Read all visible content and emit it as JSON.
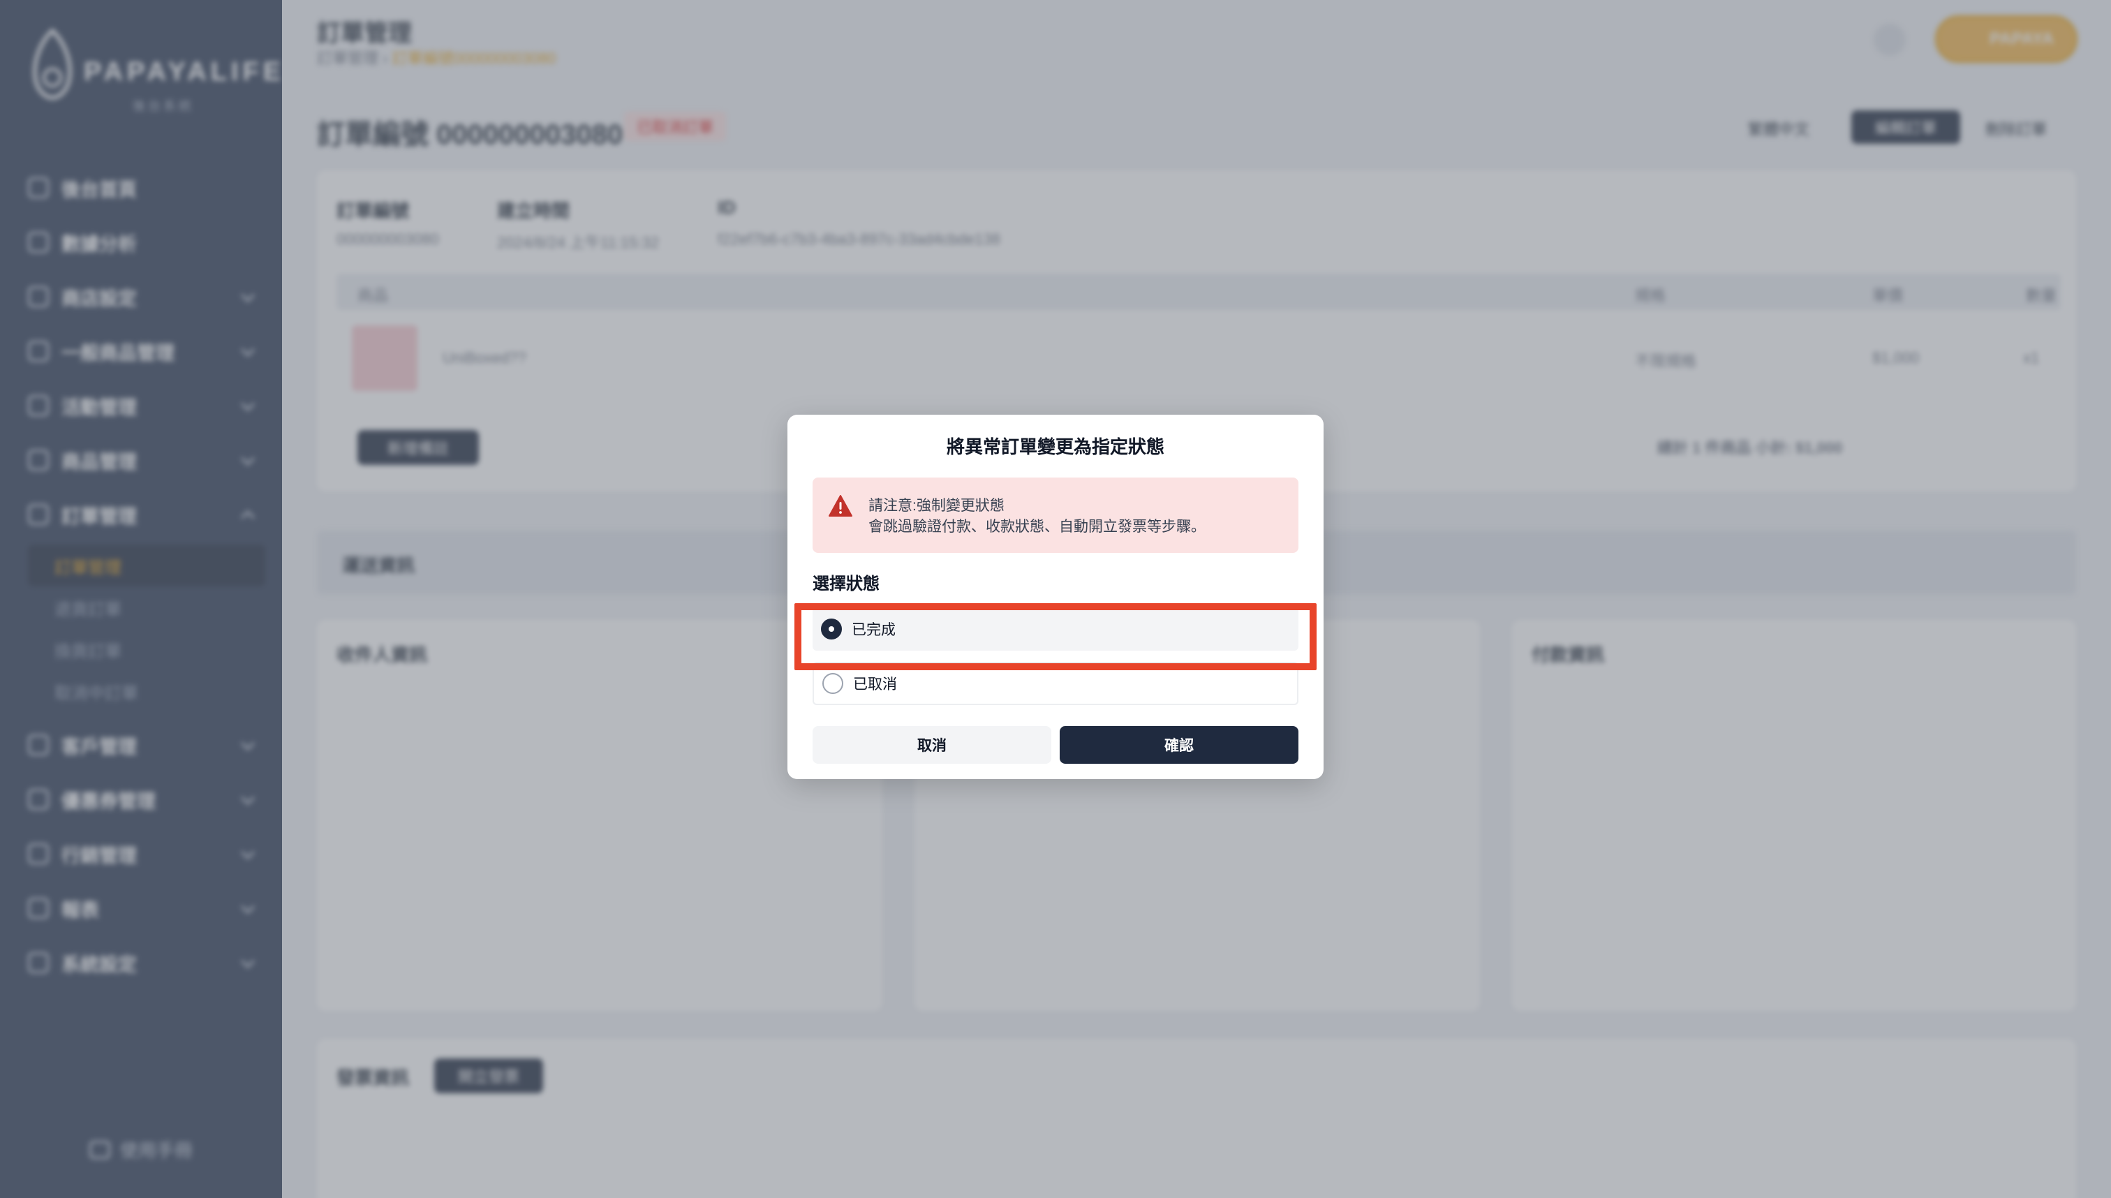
{
  "sidebar": {
    "logo_text": "PAPAYALIFE",
    "logo_sub": "後台系統",
    "items": [
      {
        "label": "後台首頁",
        "icon": "home-icon",
        "chevron": false
      },
      {
        "label": "數據分析",
        "icon": "chart-icon",
        "chevron": false
      },
      {
        "label": "商店設定",
        "icon": "store-icon",
        "chevron": true
      },
      {
        "label": "一般商品管理",
        "icon": "box-icon",
        "chevron": true
      },
      {
        "label": "活動管理",
        "icon": "calendar-icon",
        "chevron": true
      },
      {
        "label": "商品管理",
        "icon": "bag-icon",
        "chevron": true
      },
      {
        "label": "訂單管理",
        "icon": "receipt-icon",
        "chevron": true,
        "expanded": true
      }
    ],
    "sub_items": [
      "訂單管理",
      "退貨訂單",
      "換貨訂單",
      "取消中訂單"
    ],
    "items_after": [
      {
        "label": "客戶管理",
        "icon": "users-icon"
      },
      {
        "label": "優惠券管理",
        "icon": "ticket-icon"
      },
      {
        "label": "行銷管理",
        "icon": "tag-icon"
      },
      {
        "label": "報表",
        "icon": "report-icon"
      },
      {
        "label": "系統設定",
        "icon": "settings-icon"
      }
    ],
    "footer_label": "使用手冊"
  },
  "header": {
    "title": "訂單管理",
    "breadcrumb_root": "訂單管理",
    "breadcrumb_current": "訂單編號000000003080",
    "user_label": "PAPAYA"
  },
  "order": {
    "title": "訂單編號 000000003080",
    "status_badge": "已取消訂單",
    "lang": "繁體中文",
    "edit_label": "編輯訂單",
    "delete_label": "刪除訂單",
    "info": [
      {
        "label": "訂單編號",
        "value": "000000003080"
      },
      {
        "label": "建立時間",
        "value": "2024/8/24 上午11:15:32"
      },
      {
        "label": "ID",
        "value": "f22ef7b6-c7b3-4ba3-897c-33ad4cbde138"
      }
    ],
    "table_headers": [
      "商品",
      "規格",
      "單價",
      "數量"
    ],
    "item": {
      "name": "UniBoxed??",
      "spec": "不限規格",
      "price": "$1,000",
      "qty": "x1"
    },
    "add_note_label": "新增備註",
    "summary": "總計 1 件商品  小計: $1,000",
    "shipping_section": "運送資訊",
    "recipient_title": "收件人資訊",
    "payment_title": "付款資訊",
    "invoice_section": "發票資訊",
    "invoice_button": "開立發票"
  },
  "modal": {
    "title": "將異常訂單變更為指定狀態",
    "warning_title": "請注意:強制變更狀態",
    "warning_body": "會跳過驗證付款、收款狀態、自動開立發票等步驟。",
    "section_label": "選擇狀態",
    "options": [
      {
        "label": "已完成",
        "selected": true
      },
      {
        "label": "已取消",
        "selected": false
      }
    ],
    "cancel_label": "取消",
    "confirm_label": "確認"
  },
  "colors": {
    "sidebar_bg": "#2d3b55",
    "primary_dark": "#1f2a3f",
    "accent": "#e8a317",
    "warning_bg": "#fbe2e2",
    "warning_icon": "#c2322b",
    "highlight": "#e8442a"
  }
}
